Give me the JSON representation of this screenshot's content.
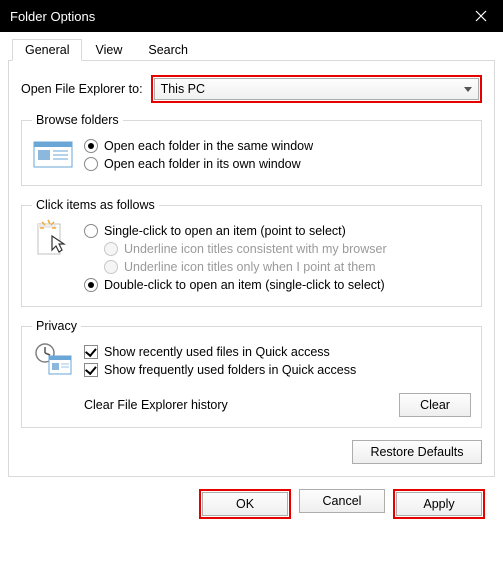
{
  "window": {
    "title": "Folder Options"
  },
  "tabs": {
    "general": "General",
    "view": "View",
    "search": "Search"
  },
  "openExplorer": {
    "label": "Open File Explorer to:",
    "value": "This PC"
  },
  "browseFolders": {
    "legend": "Browse folders",
    "sameWindow": "Open each folder in the same window",
    "ownWindow": "Open each folder in its own window"
  },
  "clickItems": {
    "legend": "Click items as follows",
    "single": "Single-click to open an item (point to select)",
    "underlineBrowser": "Underline icon titles consistent with my browser",
    "underlinePoint": "Underline icon titles only when I point at them",
    "double": "Double-click to open an item (single-click to select)"
  },
  "privacy": {
    "legend": "Privacy",
    "recentFiles": "Show recently used files in Quick access",
    "frequentFolders": "Show frequently used folders in Quick access",
    "clearLabel": "Clear File Explorer history",
    "clearBtn": "Clear"
  },
  "buttons": {
    "restore": "Restore Defaults",
    "ok": "OK",
    "cancel": "Cancel",
    "apply": "Apply"
  }
}
